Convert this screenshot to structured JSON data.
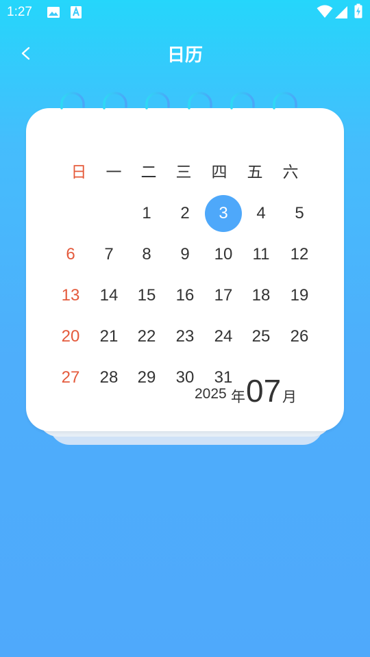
{
  "status_bar": {
    "time": "1:27",
    "icons": [
      "image-icon",
      "text-a-icon",
      "wifi-icon",
      "signal-icon",
      "battery-charging-icon"
    ]
  },
  "header": {
    "title": "日历",
    "back_icon": "chevron-left-icon"
  },
  "calendar": {
    "weekdays": [
      "日",
      "一",
      "二",
      "三",
      "四",
      "五",
      "六"
    ],
    "year": "2025",
    "year_suffix": "年",
    "month": "07",
    "month_suffix": "月",
    "today": "3",
    "days": [
      [
        "",
        "",
        "1",
        "2",
        "3",
        "4",
        "5"
      ],
      [
        "6",
        "7",
        "8",
        "9",
        "10",
        "11",
        "12"
      ],
      [
        "13",
        "14",
        "15",
        "16",
        "17",
        "18",
        "19"
      ],
      [
        "20",
        "21",
        "22",
        "23",
        "24",
        "25",
        "26"
      ],
      [
        "27",
        "28",
        "29",
        "30",
        "31",
        "",
        ""
      ]
    ]
  },
  "colors": {
    "accent": "#4ea8fa",
    "sunday": "#e45a3c",
    "ring_start": "#2fd8f5",
    "ring_end": "#4aa6f8"
  }
}
